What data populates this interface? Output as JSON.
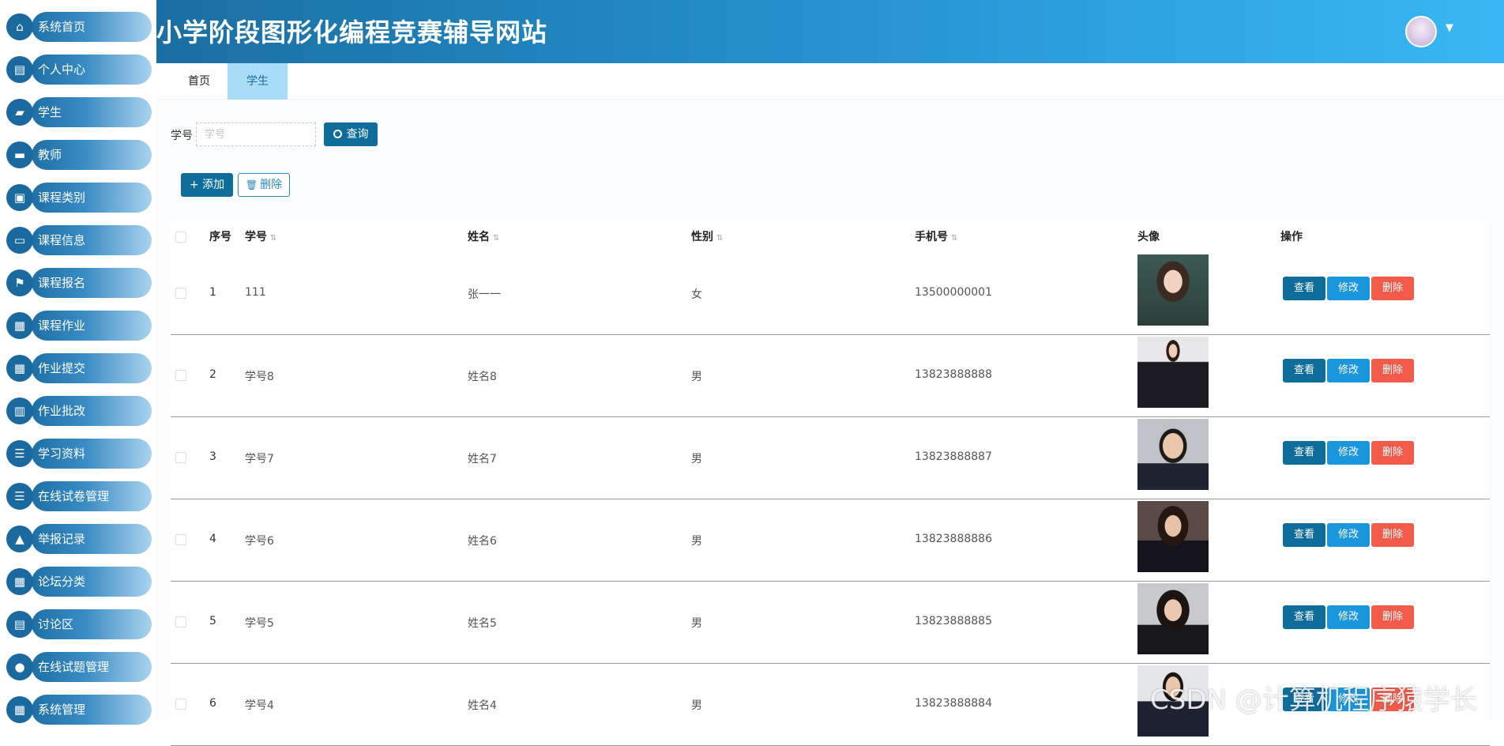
{
  "sidebar": {
    "items": [
      {
        "label": "系统首页",
        "icon": "home-icon",
        "glyph": "⌂"
      },
      {
        "label": "个人中心",
        "icon": "window-icon",
        "glyph": "▤"
      },
      {
        "label": "学生",
        "icon": "chat-icon",
        "glyph": "▰"
      },
      {
        "label": "教师",
        "icon": "inbox-icon",
        "glyph": "▬"
      },
      {
        "label": "课程类别",
        "icon": "clipboard-icon",
        "glyph": "▣"
      },
      {
        "label": "课程信息",
        "icon": "monitor-icon",
        "glyph": "▭"
      },
      {
        "label": "课程报名",
        "icon": "flag-icon",
        "glyph": "⚑"
      },
      {
        "label": "课程作业",
        "icon": "grid-icon",
        "glyph": "▦"
      },
      {
        "label": "作业提交",
        "icon": "grid-icon",
        "glyph": "▦"
      },
      {
        "label": "作业批改",
        "icon": "briefcase-icon",
        "glyph": "▥"
      },
      {
        "label": "学习资料",
        "icon": "list-icon",
        "glyph": "☰"
      },
      {
        "label": "在线试卷管理",
        "icon": "list-icon",
        "glyph": "☰"
      },
      {
        "label": "举报记录",
        "icon": "thumb-icon",
        "glyph": "▲"
      },
      {
        "label": "论坛分类",
        "icon": "grid-icon",
        "glyph": "▦"
      },
      {
        "label": "讨论区",
        "icon": "document-icon",
        "glyph": "▤"
      },
      {
        "label": "在线试题管理",
        "icon": "bulb-icon",
        "glyph": "●"
      },
      {
        "label": "系统管理",
        "icon": "grid-icon",
        "glyph": "▦"
      }
    ]
  },
  "header": {
    "title": "小学阶段图形化编程竞赛辅导网站",
    "caret": "▼"
  },
  "tabs": [
    {
      "label": "首页",
      "active": false
    },
    {
      "label": "学生",
      "active": true
    }
  ],
  "search": {
    "label": "学号",
    "placeholder": "学号",
    "value": "",
    "button": "查询",
    "button_icon": "search-icon"
  },
  "toolbar": {
    "add": "+ 添加",
    "delete": "删除"
  },
  "table": {
    "columns": [
      "序号",
      "学号",
      "姓名",
      "性别",
      "手机号",
      "头像",
      "操作"
    ],
    "rows": [
      {
        "index": "1",
        "student_id": "111",
        "name": "张一一",
        "gender": "女",
        "phone": "13500000001"
      },
      {
        "index": "2",
        "student_id": "学号8",
        "name": "姓名8",
        "gender": "男",
        "phone": "13823888888"
      },
      {
        "index": "3",
        "student_id": "学号7",
        "name": "姓名7",
        "gender": "男",
        "phone": "13823888887"
      },
      {
        "index": "4",
        "student_id": "学号6",
        "name": "姓名6",
        "gender": "男",
        "phone": "13823888886"
      },
      {
        "index": "5",
        "student_id": "学号5",
        "name": "姓名5",
        "gender": "男",
        "phone": "13823888885"
      },
      {
        "index": "6",
        "student_id": "学号4",
        "name": "姓名4",
        "gender": "男",
        "phone": "13823888884"
      }
    ],
    "actions": {
      "view": "查看",
      "edit": "修改",
      "delete": "删除"
    }
  },
  "watermark": "CSDN @计算机程序猿学长",
  "colors": {
    "primary": "#0f6d9c",
    "edit": "#1996dc",
    "danger": "#f25a4a",
    "tab_active": "#a8dcf7"
  }
}
